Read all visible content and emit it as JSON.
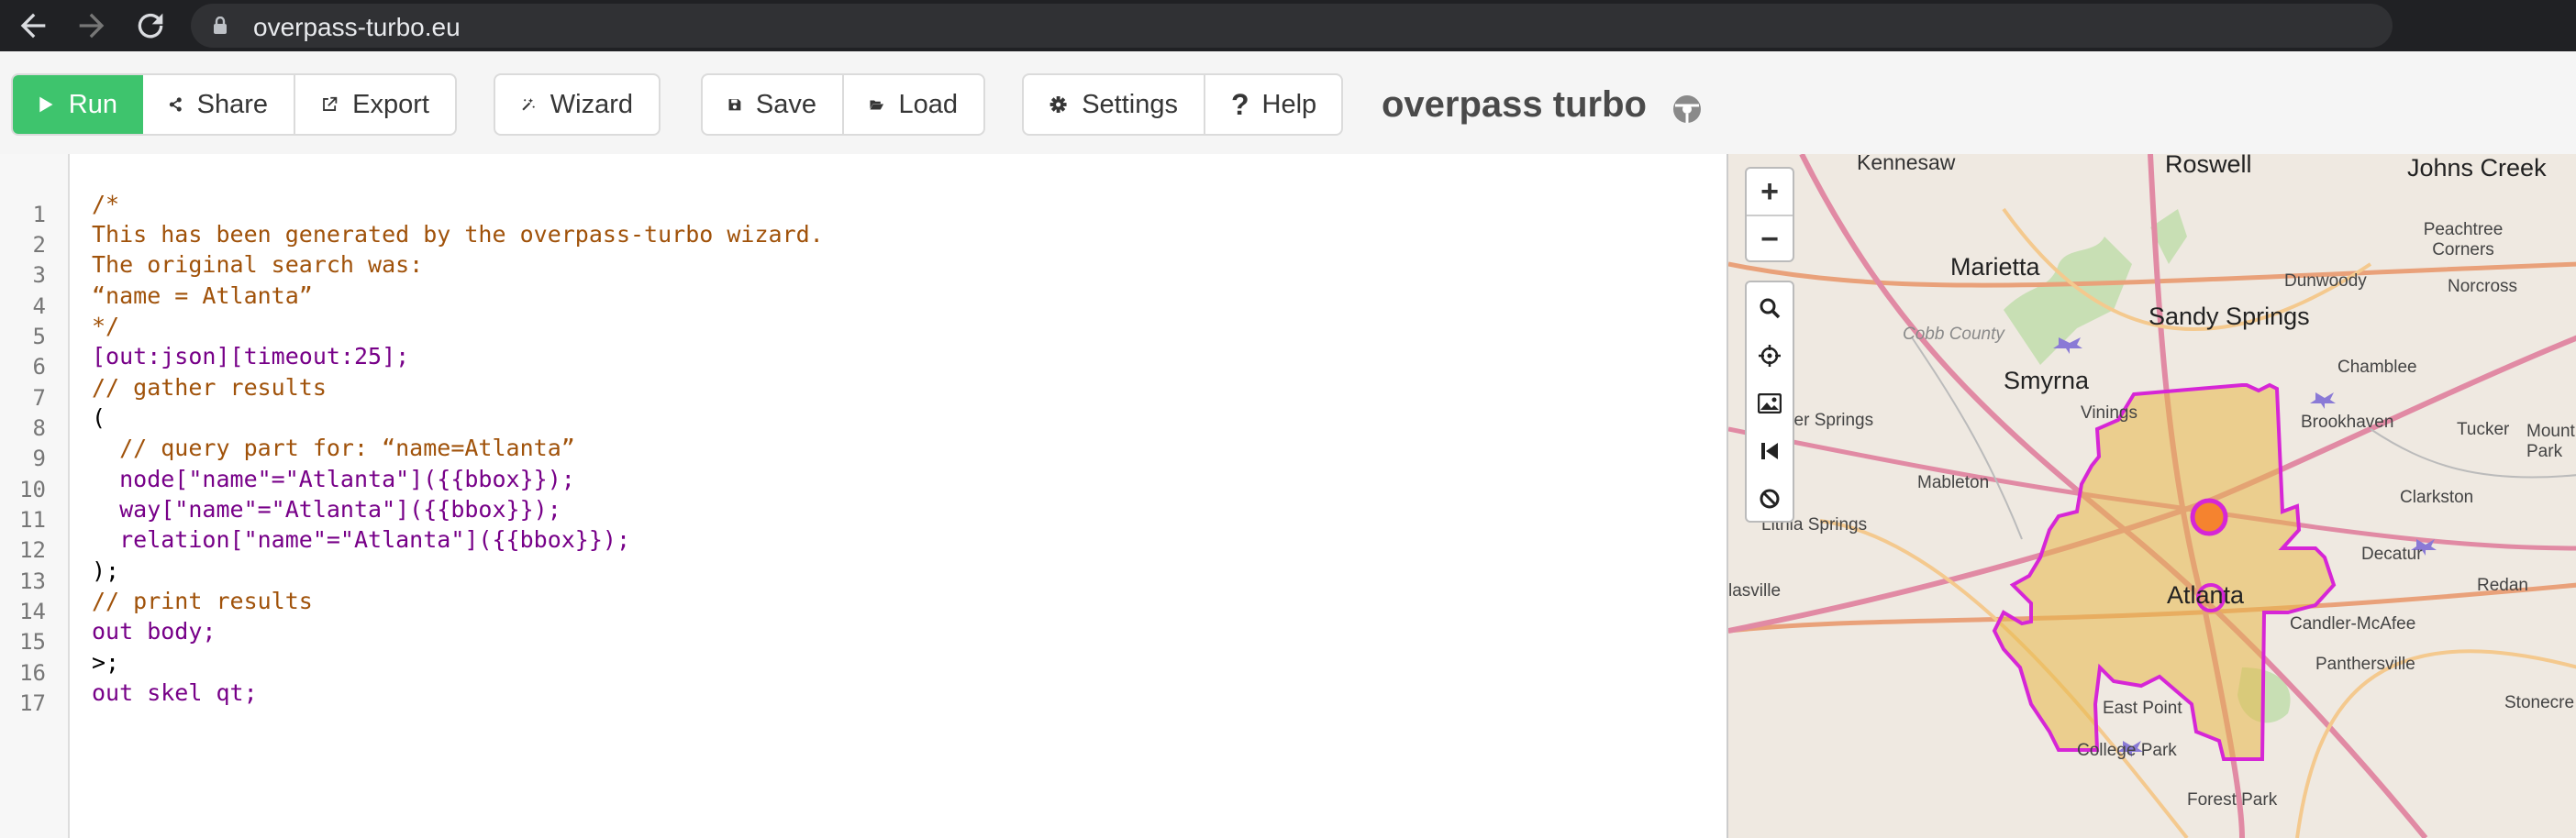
{
  "browser": {
    "url": "overpass-turbo.eu",
    "icons": [
      "back-arrow-icon",
      "forward-arrow-icon",
      "reload-icon",
      "lock-icon"
    ]
  },
  "toolbar": {
    "run_label": "Run",
    "share_label": "Share",
    "export_label": "Export",
    "wizard_label": "Wizard",
    "save_label": "Save",
    "load_label": "Load",
    "settings_label": "Settings",
    "help_label": "Help",
    "app_title": "overpass turbo",
    "accent": "#3ec46d"
  },
  "editor": {
    "line_numbers": [
      "1",
      "2",
      "3",
      "4",
      "5",
      "6",
      "7",
      "8",
      "9",
      "10",
      "11",
      "12",
      "13",
      "14",
      "15",
      "16",
      "17"
    ],
    "lines": [
      "/*",
      "This has been generated by the overpass-turbo wizard.",
      "The original search was:",
      "“name = Atlanta”",
      "*/",
      "[out:json][timeout:25];",
      "// gather results",
      "(",
      "  // query part for: “name=Atlanta”",
      "  node[\"name\"=\"Atlanta\"]({{bbox}});",
      "  way[\"name\"=\"Atlanta\"]({{bbox}});",
      "  relation[\"name\"=\"Atlanta\"]({{bbox}});",
      ");",
      "// print results",
      "out body;",
      ">;",
      "out skel qt;"
    ]
  },
  "map": {
    "zoom_in": "+",
    "zoom_out": "−",
    "tool_icons": [
      "search-icon",
      "crosshair-icon",
      "image-icon",
      "skip-back-icon",
      "block-icon"
    ],
    "labels": {
      "kennesaw": "Kennesaw",
      "roswell": "Roswell",
      "johns_creek": "Johns Creek",
      "marietta": "Marietta",
      "peachtree_corners": "Peachtree Corners",
      "dunwoody": "Dunwoody",
      "sandy_springs": "Sandy Springs",
      "norcross": "Norcross",
      "cobb_county": "Cobb County",
      "smyrna": "Smyrna",
      "vinings": "Vinings",
      "chamblee": "Chamblee",
      "powder_springs": "Powder Springs",
      "brookhaven": "Brookhaven",
      "tucker": "Tucker",
      "mount_park": "Mount Park",
      "mableton": "Mableton",
      "clarkston": "Clarkston",
      "lithia_springs": "Lithia Springs",
      "decatur": "Decatur",
      "atlanta": "Atlanta",
      "redan": "Redan",
      "douglasville": "lasville",
      "candler_mcafee": "Candler-McAfee",
      "panthersville": "Panthersville",
      "east_point": "East Point",
      "stonecrest": "Stonecre",
      "college_park": "College Park",
      "forest_park": "Forest Park"
    },
    "colors": {
      "boundary": "#d626d6",
      "fill": "#e8b84a",
      "node": "#f5832f"
    }
  }
}
